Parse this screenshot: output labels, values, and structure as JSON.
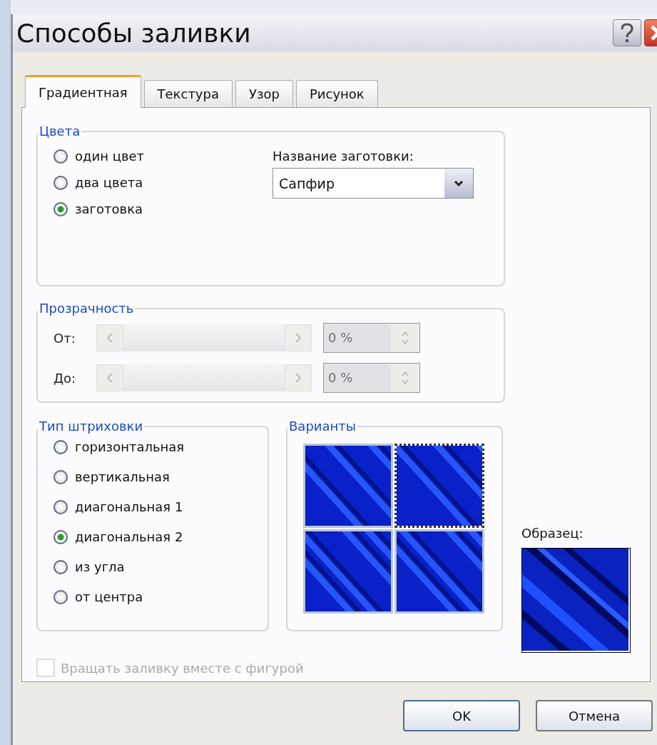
{
  "window": {
    "title": "Способы заливки"
  },
  "tabs": [
    {
      "label": "Градиентная",
      "selected": true
    },
    {
      "label": "Текстура",
      "selected": false
    },
    {
      "label": "Узор",
      "selected": false
    },
    {
      "label": "Рисунок",
      "selected": false
    }
  ],
  "colors": {
    "legend": "Цвета",
    "options": [
      {
        "label": "один цвет",
        "selected": false
      },
      {
        "label": "два цвета",
        "selected": false
      },
      {
        "label": "заготовка",
        "selected": true
      }
    ],
    "preset_label": "Название заготовки:",
    "preset_value": "Сапфир"
  },
  "transparency": {
    "legend": "Прозрачность",
    "disabled": true,
    "rows": [
      {
        "label": "От:",
        "value": "0 %"
      },
      {
        "label": "До:",
        "value": "0 %"
      }
    ]
  },
  "shading": {
    "legend": "Тип штриховки",
    "options": [
      {
        "label": "горизонтальная",
        "selected": false
      },
      {
        "label": "вертикальная",
        "selected": false
      },
      {
        "label": "диагональная 1",
        "selected": false
      },
      {
        "label": "диагональная 2",
        "selected": true
      },
      {
        "label": "из угла",
        "selected": false
      },
      {
        "label": "от центра",
        "selected": false
      }
    ]
  },
  "variants": {
    "legend": "Варианты",
    "items": [
      {
        "selected": false
      },
      {
        "selected": true
      },
      {
        "selected": false
      },
      {
        "selected": false
      }
    ]
  },
  "sample": {
    "label": "Образец:"
  },
  "rotate_checkbox": {
    "label": "Вращать заливку вместе с фигурой",
    "checked": false,
    "disabled": true
  },
  "buttons": [
    "OK",
    "Отмена"
  ]
}
